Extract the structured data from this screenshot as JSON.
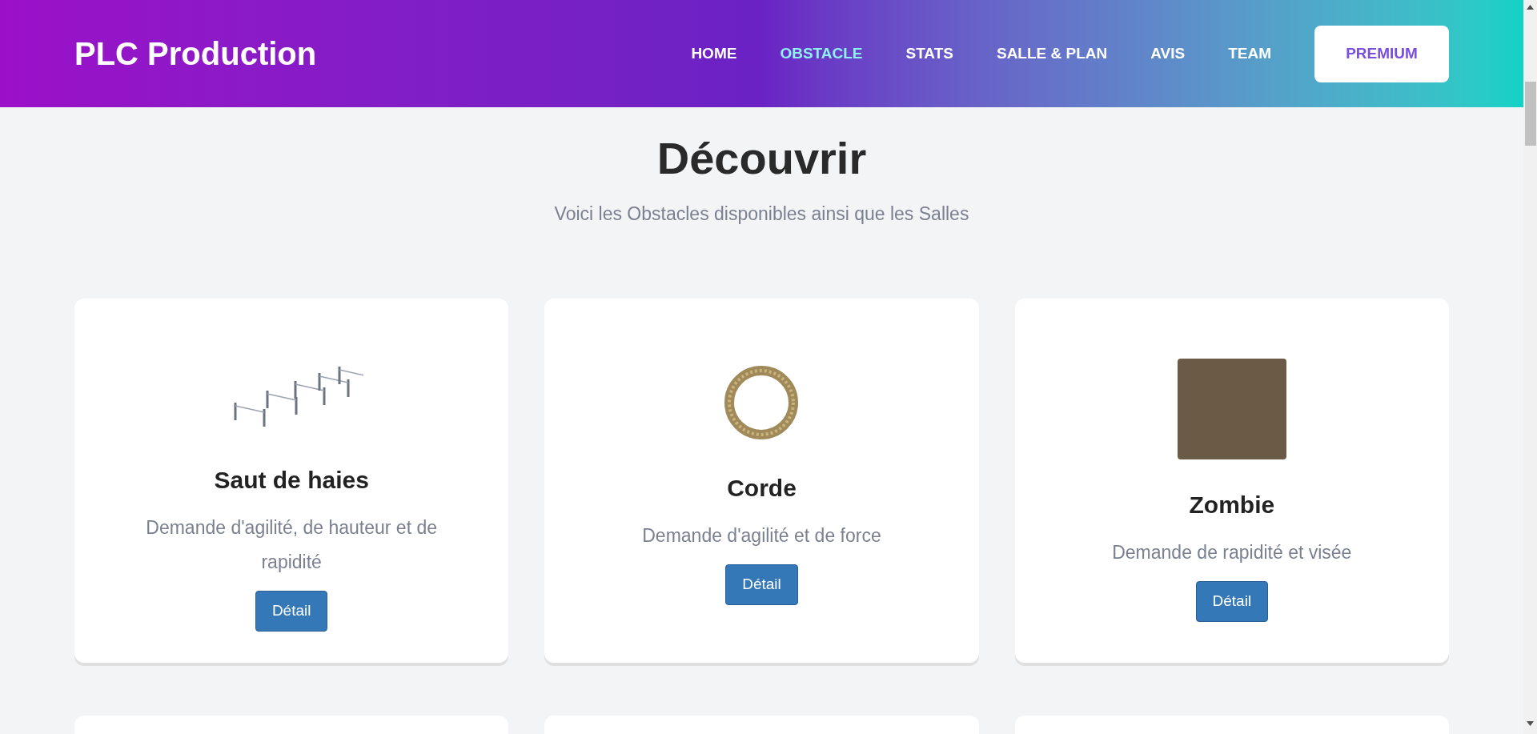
{
  "header": {
    "logo": "PLC Production",
    "nav": [
      {
        "label": "HOME",
        "selected": false
      },
      {
        "label": "OBSTACLE",
        "selected": true
      },
      {
        "label": "STATS",
        "selected": false
      },
      {
        "label": "SALLE & PLAN",
        "selected": false
      },
      {
        "label": "AVIS",
        "selected": false
      },
      {
        "label": "TEAM",
        "selected": false
      }
    ],
    "cta": "PREMIUM"
  },
  "intro": {
    "title": "Découvrir",
    "subtitle": "Voici les Obstacles disponibles ainsi que les Salles"
  },
  "cards": [
    {
      "kind": "hurdles",
      "title": "Saut de haies",
      "description": "Demande d'agilité, de hauteur et de rapidité",
      "button": "Détail"
    },
    {
      "kind": "rope",
      "title": "Corde",
      "description": "Demande d'agilité et de force",
      "button": "Détail"
    },
    {
      "kind": "photo",
      "title": "Zombie",
      "description": "Demande de rapidité et visée",
      "button": "Détail"
    }
  ]
}
